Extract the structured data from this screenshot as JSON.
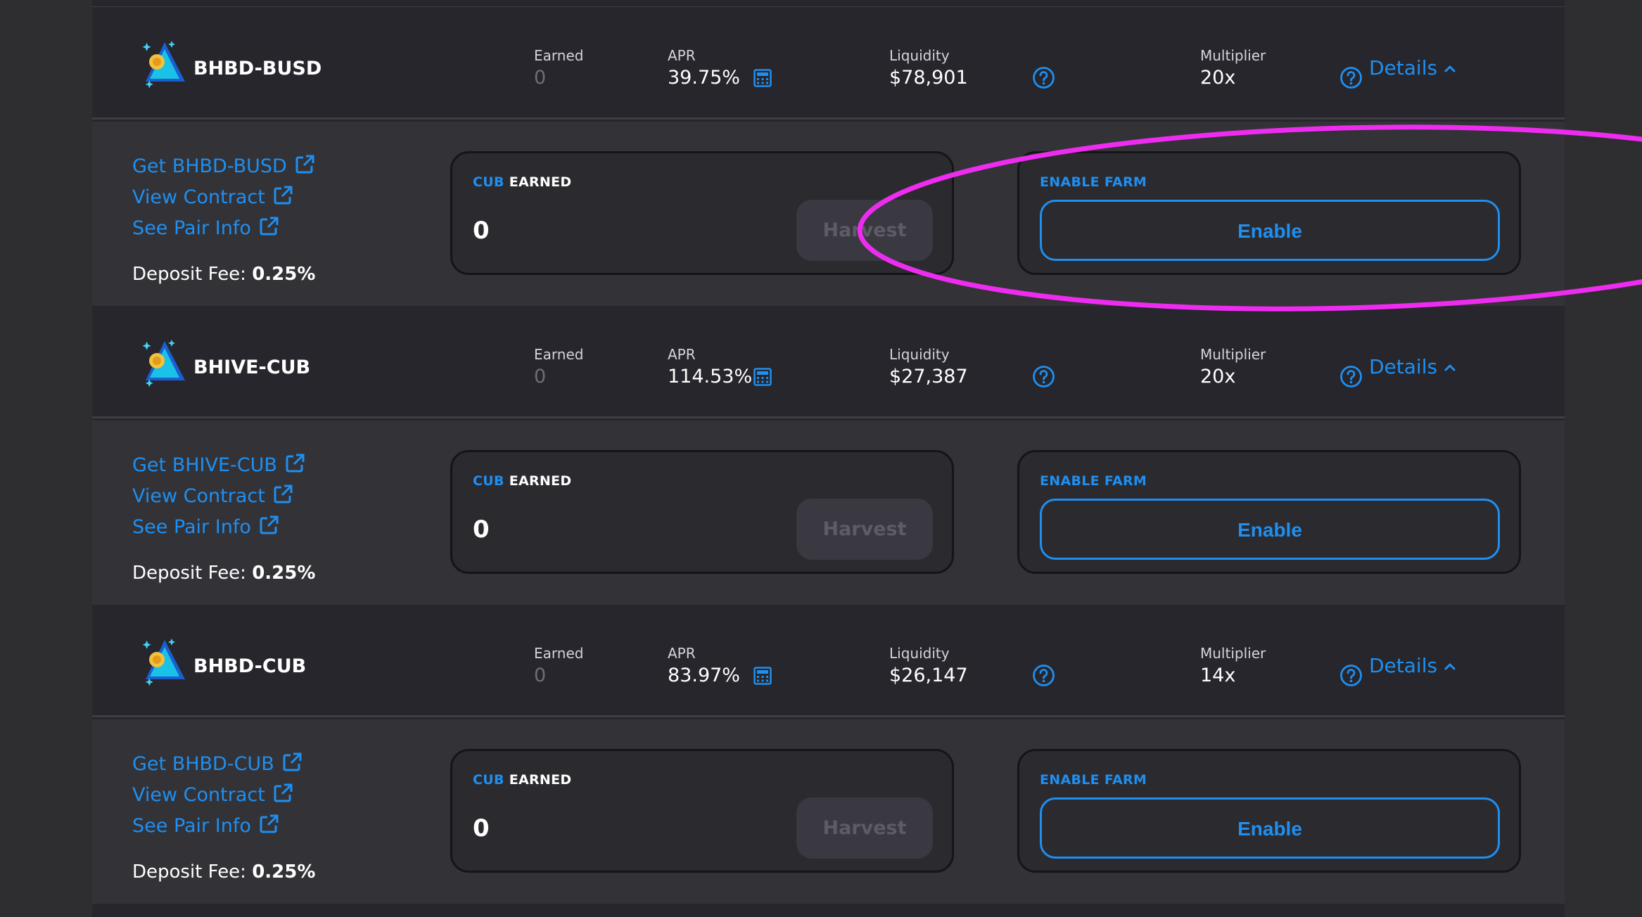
{
  "colors": {
    "accent": "#1f8ff0",
    "annotation": "#ee2cf0",
    "background": "#2e2e31",
    "row_header_bg": "#27262c",
    "row_details_bg": "#333237"
  },
  "farms": [
    {
      "pair": "BHBD-BUSD",
      "earned_label": "Earned",
      "earned": "0",
      "apr_label": "APR",
      "apr": "39.75%",
      "liquidity_label": "Liquidity",
      "liquidity": "$78,901",
      "multiplier_label": "Multiplier",
      "multiplier": "20x",
      "details_label": "Details",
      "get_link": "Get BHBD-BUSD",
      "view_contract": "View Contract",
      "pair_info": "See Pair Info",
      "deposit_fee_label": "Deposit Fee:",
      "deposit_fee": "0.25%",
      "earned_card_prefix": "CUB",
      "earned_card_suffix": "EARNED",
      "earned_amount": "0",
      "harvest_label": "Harvest",
      "enable_farm_label": "ENABLE FARM",
      "enable_label": "Enable"
    },
    {
      "pair": "BHIVE-CUB",
      "earned_label": "Earned",
      "earned": "0",
      "apr_label": "APR",
      "apr": "114.53%",
      "liquidity_label": "Liquidity",
      "liquidity": "$27,387",
      "multiplier_label": "Multiplier",
      "multiplier": "20x",
      "details_label": "Details",
      "get_link": "Get BHIVE-CUB",
      "view_contract": "View Contract",
      "pair_info": "See Pair Info",
      "deposit_fee_label": "Deposit Fee:",
      "deposit_fee": "0.25%",
      "earned_card_prefix": "CUB",
      "earned_card_suffix": "EARNED",
      "earned_amount": "0",
      "harvest_label": "Harvest",
      "enable_farm_label": "ENABLE FARM",
      "enable_label": "Enable"
    },
    {
      "pair": "BHBD-CUB",
      "earned_label": "Earned",
      "earned": "0",
      "apr_label": "APR",
      "apr": "83.97%",
      "liquidity_label": "Liquidity",
      "liquidity": "$26,147",
      "multiplier_label": "Multiplier",
      "multiplier": "14x",
      "details_label": "Details",
      "get_link": "Get BHBD-CUB",
      "view_contract": "View Contract",
      "pair_info": "See Pair Info",
      "deposit_fee_label": "Deposit Fee:",
      "deposit_fee": "0.25%",
      "earned_card_prefix": "CUB",
      "earned_card_suffix": "EARNED",
      "earned_amount": "0",
      "harvest_label": "Harvest",
      "enable_farm_label": "ENABLE FARM",
      "enable_label": "Enable"
    }
  ]
}
